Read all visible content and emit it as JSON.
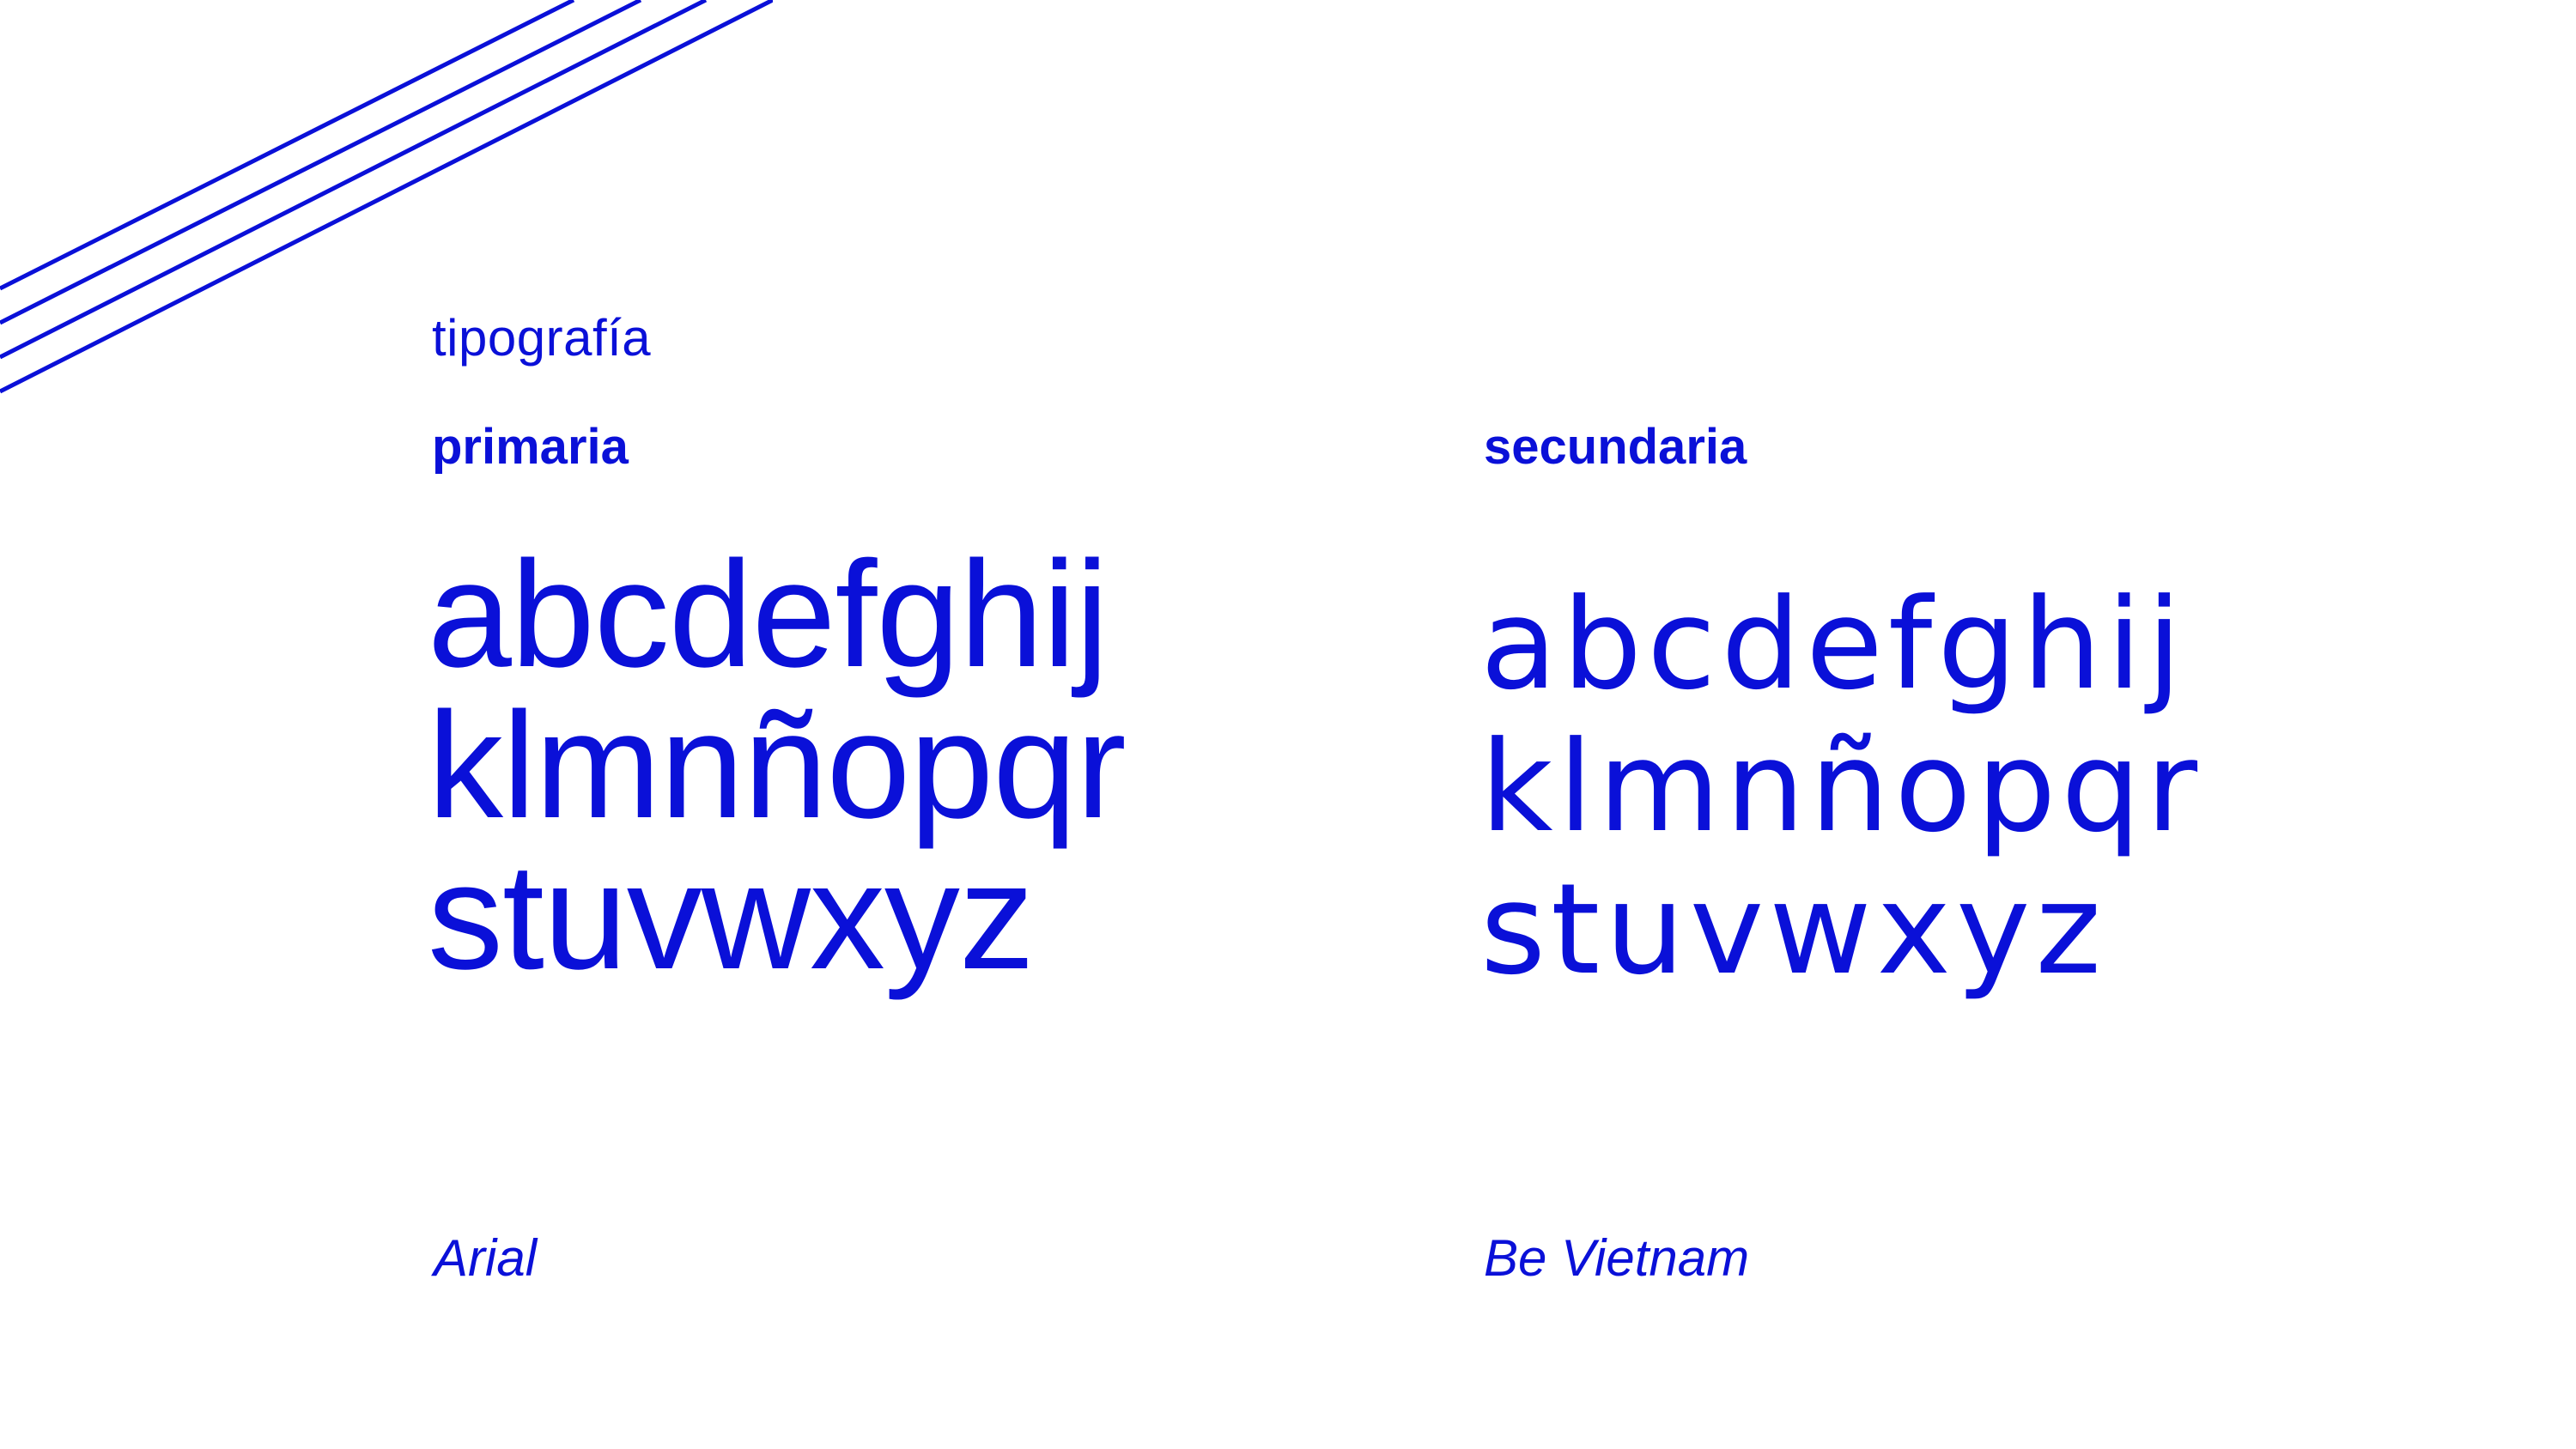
{
  "header": {
    "section_title": "tipografía"
  },
  "columns": [
    {
      "label": "primaria",
      "alphabet_lines": [
        "abcdefghij",
        "klmnñopqr",
        "stuvwxyz"
      ],
      "font_name": "Arial"
    },
    {
      "label": "secundaria",
      "alphabet_lines": [
        "abcdefghij",
        "klmnñopqr",
        "stuvwxyz"
      ],
      "font_name": "Be Vietnam"
    }
  ],
  "colors": {
    "accent": "#0a10d8",
    "background": "#ffffff"
  },
  "icons": {
    "decoration": "diagonal-lines-icon"
  }
}
